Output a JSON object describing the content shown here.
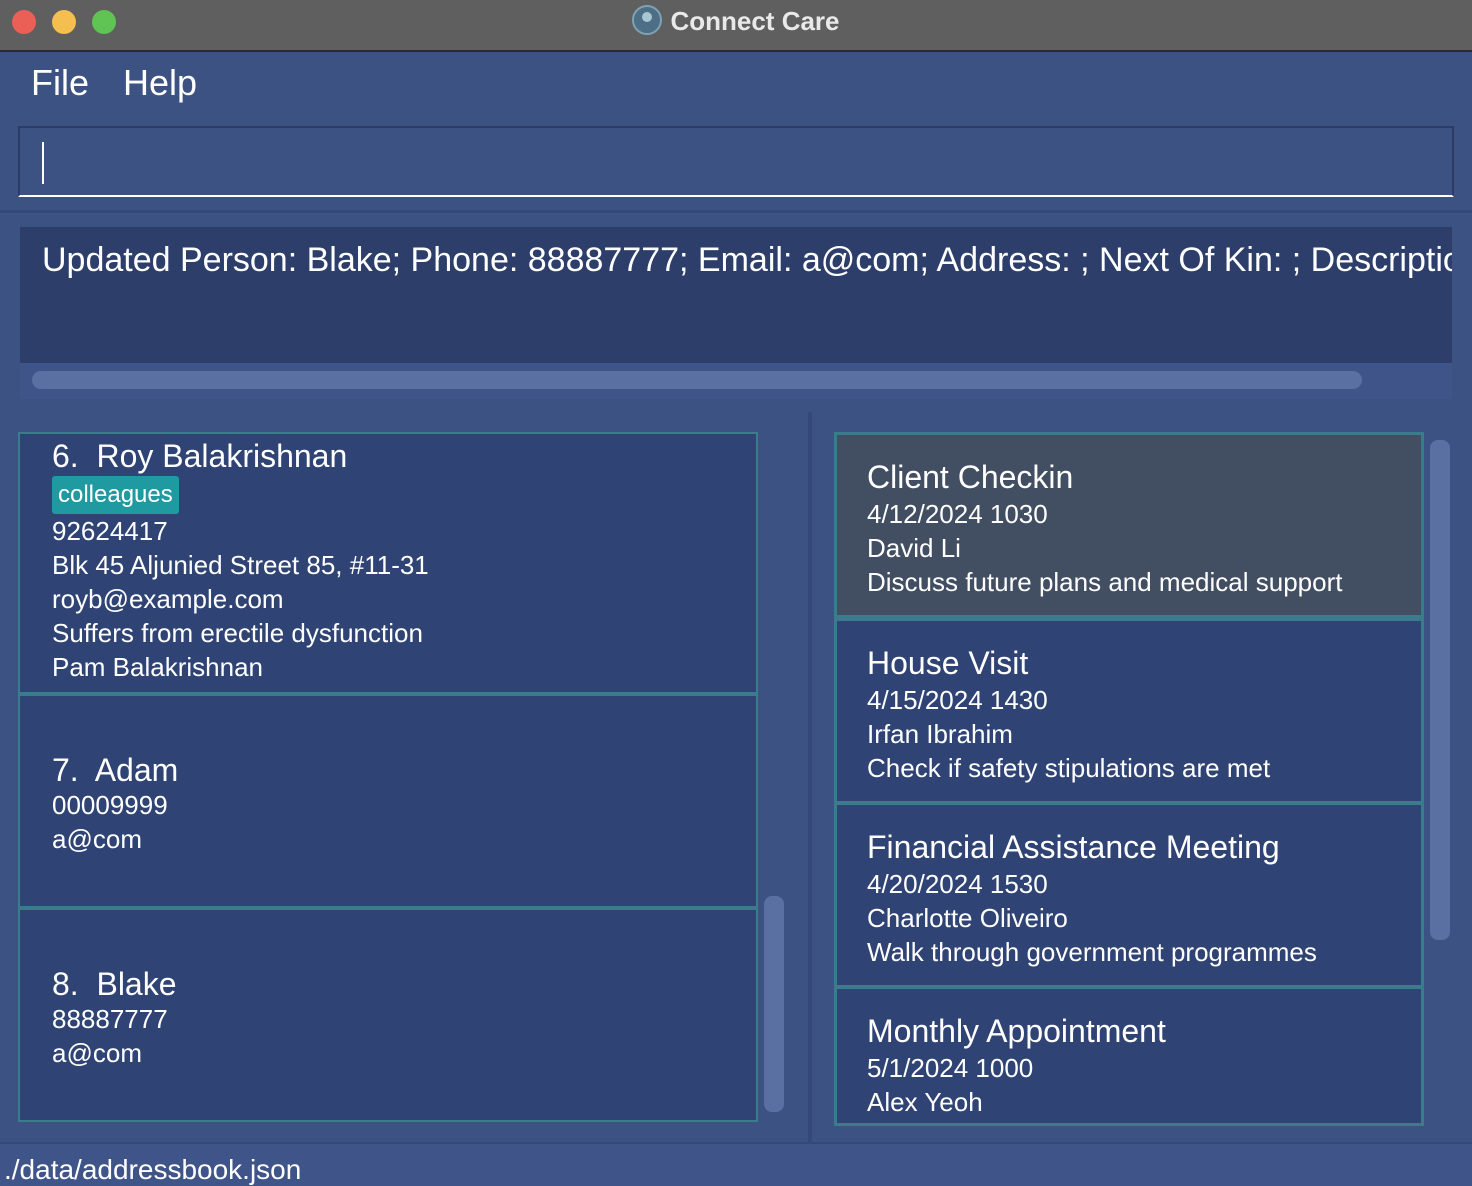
{
  "window": {
    "title": "Connect Care",
    "icon": "app-logo-icon"
  },
  "menu": {
    "file": "File",
    "help": "Help"
  },
  "command": {
    "value": ""
  },
  "result": {
    "text": "Updated Person: Blake; Phone: 88887777; Email: a@com; Address: ; Next Of Kin: ; Description: ; Tags: "
  },
  "persons": [
    {
      "index": "6.",
      "name": "Roy Balakrishnan",
      "tag": "colleagues",
      "phone": "92624417",
      "address": "Blk 45 Aljunied Street 85, #11-31",
      "email": "royb@example.com",
      "description": "Suffers from erectile dysfunction",
      "next_of_kin": "Pam Balakrishnan"
    },
    {
      "index": "7.",
      "name": "Adam",
      "phone": "00009999",
      "email": "a@com"
    },
    {
      "index": "8.",
      "name": "Blake",
      "phone": "88887777",
      "email": "a@com"
    }
  ],
  "appointments": [
    {
      "title": "Client Checkin",
      "datetime": "4/12/2024 1030",
      "person": "David Li",
      "description": "Discuss future plans and medical support"
    },
    {
      "title": "House Visit",
      "datetime": "4/15/2024 1430",
      "person": "Irfan Ibrahim",
      "description": "Check if safety stipulations are met"
    },
    {
      "title": "Financial Assistance Meeting",
      "datetime": "4/20/2024 1530",
      "person": "Charlotte Oliveiro",
      "description": "Walk through government programmes"
    },
    {
      "title": "Monthly Appointment",
      "datetime": "5/1/2024 1000",
      "person": "Alex Yeoh"
    }
  ],
  "status": {
    "path": "./data/addressbook.json"
  },
  "colors": {
    "background": "#3c5283",
    "card": "#2f4374",
    "card_border": "#3a7c8c",
    "selected_card": "#424e61",
    "tag": "#1f9aa0"
  }
}
